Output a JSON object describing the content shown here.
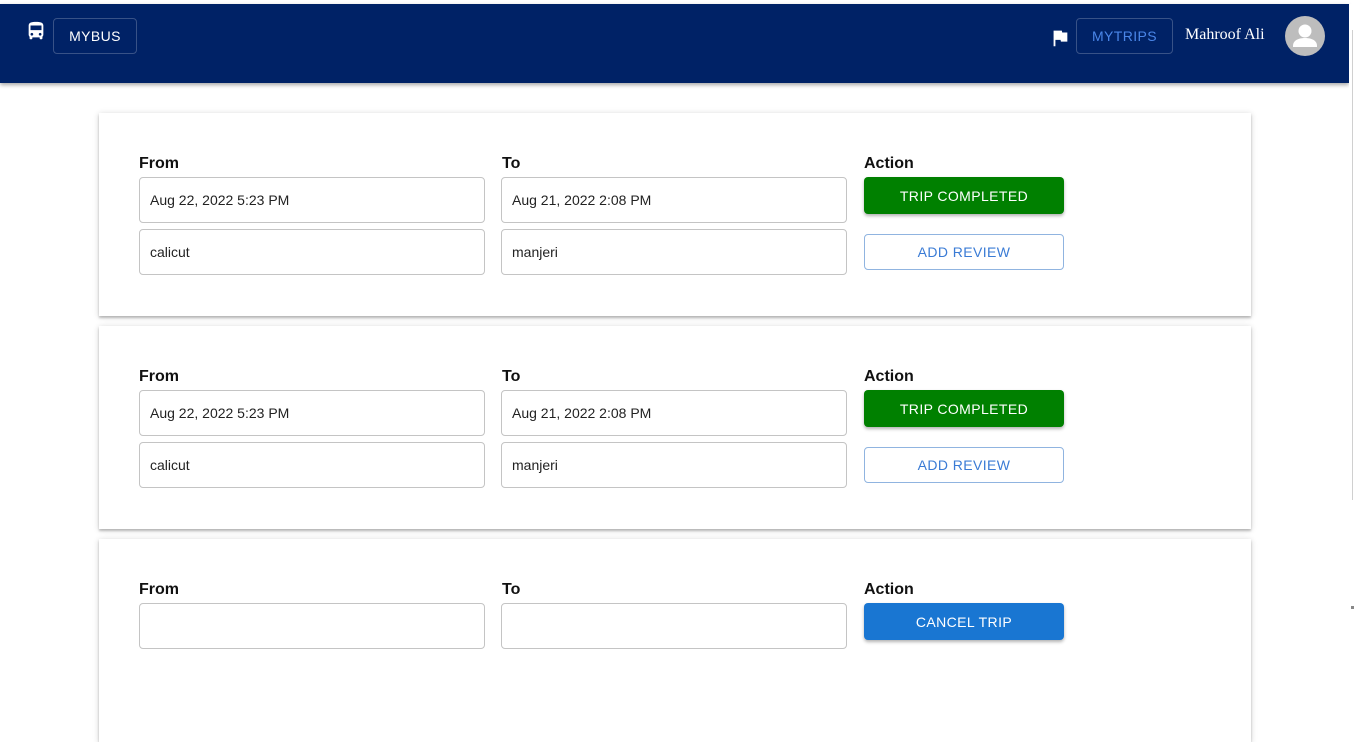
{
  "header": {
    "brand_label": "MYBUS",
    "mytrips_label": "MYTRIPS",
    "user_name": "Mahroof Ali",
    "icons": [
      "bus-icon",
      "flag-icon",
      "avatar-icon"
    ],
    "colors": {
      "appbar": "#002266",
      "mytrips_text": "#4a86e8"
    }
  },
  "labels": {
    "from": "From",
    "to": "To",
    "action": "Action"
  },
  "trips": [
    {
      "from_time": "Aug 22, 2022 5:23 PM",
      "to_time": "Aug 21, 2022 2:08 PM",
      "from_place": "calicut",
      "to_place": "manjeri",
      "status_label": "TRIP COMPLETED",
      "review_label": "ADD REVIEW"
    },
    {
      "from_time": "Aug 22, 2022 5:23 PM",
      "to_time": "Aug 21, 2022 2:08 PM",
      "from_place": "calicut",
      "to_place": "manjeri",
      "status_label": "TRIP COMPLETED",
      "review_label": "ADD REVIEW"
    },
    {
      "action_label": "CANCEL TRIP"
    }
  ],
  "colors": {
    "completed": "#008000",
    "cancel": "#1976d2",
    "review_outline": "#3a7bd5"
  }
}
